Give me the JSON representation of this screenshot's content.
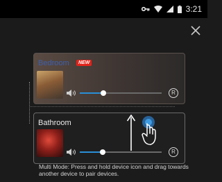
{
  "status_bar": {
    "time": "3:21",
    "icons": [
      "vpn-key-icon",
      "wifi-icon",
      "cell-signal-icon",
      "battery-icon"
    ]
  },
  "close_icon": "close-icon",
  "rooms": [
    {
      "name": "Bedroom",
      "badge": "NEW",
      "volume_fraction": 0.29,
      "role_label": "R",
      "thumb": "album-art"
    },
    {
      "name": "Bathroom",
      "volume_fraction": 0.28,
      "role_label": "R",
      "thumb": "album-art"
    }
  ],
  "gesture": {
    "arrow": "arrow-up-icon",
    "hand": "hand-tap-icon"
  },
  "hint": "Multi Mode: Press and hold device icon and drag towards another device to pair devices.",
  "colors": {
    "accent": "#2a8fd8",
    "badge": "#e2231a",
    "bedroom_title": "#3d5fae"
  }
}
